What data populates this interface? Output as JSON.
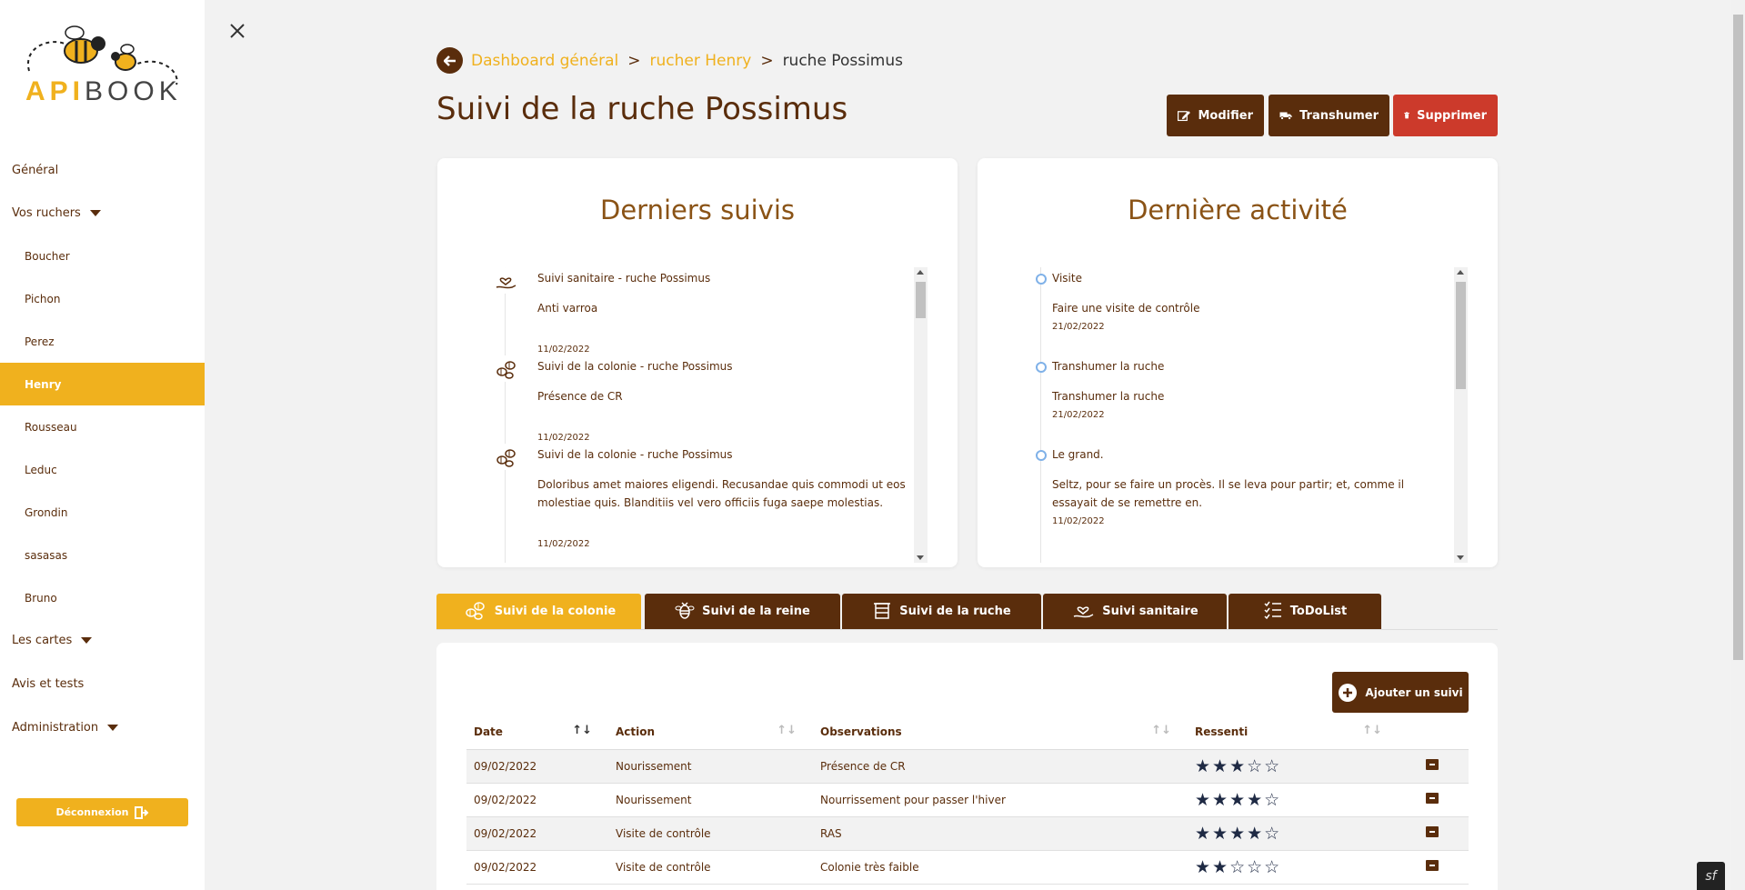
{
  "app": {
    "logo_brand": "API",
    "logo_suffix": "BOOK",
    "colors": {
      "primary": "#5a2d0c",
      "accent": "#f0b11e",
      "danger": "#cc3a2b"
    }
  },
  "sidebar": {
    "items": [
      {
        "label": "Général",
        "type": "top"
      },
      {
        "label": "Vos ruchers",
        "type": "top",
        "caret": true
      },
      {
        "label": "Boucher",
        "type": "sub"
      },
      {
        "label": "Pichon",
        "type": "sub"
      },
      {
        "label": "Perez",
        "type": "sub"
      },
      {
        "label": "Henry",
        "type": "sub",
        "active": true
      },
      {
        "label": "Rousseau",
        "type": "sub"
      },
      {
        "label": "Leduc",
        "type": "sub"
      },
      {
        "label": "Grondin",
        "type": "sub"
      },
      {
        "label": "sasasas",
        "type": "sub"
      },
      {
        "label": "Bruno",
        "type": "sub"
      },
      {
        "label": "Les cartes",
        "type": "top",
        "caret": true
      },
      {
        "label": "Avis et tests",
        "type": "top"
      },
      {
        "label": "Administration",
        "type": "top",
        "caret": true
      }
    ],
    "logout_label": "Déconnexion"
  },
  "breadcrumb": {
    "items": [
      "Dashboard général",
      "rucher Henry"
    ],
    "current": "ruche Possimus",
    "separator": ">"
  },
  "page": {
    "title": "Suivi de la ruche Possimus",
    "buttons": {
      "edit": "Modifier",
      "move": "Transhumer",
      "delete": "Supprimer"
    }
  },
  "last_followups": {
    "title": "Derniers suivis",
    "items": [
      {
        "icon": "heart-hand-icon",
        "title": "Suivi sanitaire - ruche Possimus",
        "desc": "Anti varroa",
        "date": "11/02/2022"
      },
      {
        "icon": "bees-icon",
        "title": "Suivi de la colonie - ruche Possimus",
        "desc": "Présence de CR",
        "date": "11/02/2022"
      },
      {
        "icon": "bees-icon",
        "title": "Suivi de la colonie - ruche Possimus",
        "desc": "Doloribus amet maiores eligendi. Recusandae quis commodi ut eos molestiae quis. Blanditiis vel vero officiis fuga saepe molestias.",
        "date": "11/02/2022"
      }
    ]
  },
  "last_activity": {
    "title": "Dernière activité",
    "items": [
      {
        "title": "Visite",
        "desc": "Faire une visite de contrôle",
        "date": "21/02/2022"
      },
      {
        "title": "Transhumer la ruche",
        "desc": "Transhumer la ruche",
        "date": "21/02/2022"
      },
      {
        "title": "Le grand.",
        "desc": "Seltz, pour se faire un procès. Il se leva pour partir; et, comme il essayait de se remettre en.",
        "date": "11/02/2022"
      }
    ]
  },
  "tabs": [
    {
      "label": "Suivi de la colonie",
      "icon": "bees-icon",
      "active": true
    },
    {
      "label": "Suivi de la reine",
      "icon": "queen-bee-icon"
    },
    {
      "label": "Suivi de la ruche",
      "icon": "hive-icon"
    },
    {
      "label": "Suivi sanitaire",
      "icon": "heart-hand-icon"
    },
    {
      "label": "ToDoList",
      "icon": "checklist-icon"
    }
  ],
  "table": {
    "add_label": "Ajouter un suivi",
    "columns": [
      "Date",
      "Action",
      "Observations",
      "Ressenti"
    ],
    "rows": [
      {
        "date": "09/02/2022",
        "action": "Nourissement",
        "obs": "Présence de CR",
        "rating": 3
      },
      {
        "date": "09/02/2022",
        "action": "Nourissement",
        "obs": "Nourrissement pour passer l'hiver",
        "rating": 4
      },
      {
        "date": "09/02/2022",
        "action": "Visite de contrôle",
        "obs": "RAS",
        "rating": 4
      },
      {
        "date": "09/02/2022",
        "action": "Visite de contrôle",
        "obs": "Colonie très faible",
        "rating": 2
      }
    ],
    "rating_max": 5
  }
}
